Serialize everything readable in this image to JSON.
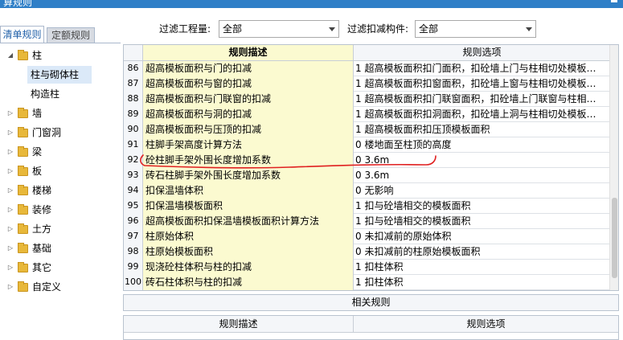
{
  "window": {
    "title": "算规则"
  },
  "tabs": [
    {
      "label": "清单规则",
      "active": true
    },
    {
      "label": "定额规则",
      "active": false
    }
  ],
  "tree": [
    {
      "label": "柱",
      "expanded": true
    },
    {
      "label": "柱与砌体柱",
      "selected": true
    },
    {
      "label": "构造柱"
    },
    {
      "label": "墙"
    },
    {
      "label": "门窗洞"
    },
    {
      "label": "梁"
    },
    {
      "label": "板"
    },
    {
      "label": "楼梯"
    },
    {
      "label": "装修"
    },
    {
      "label": "土方"
    },
    {
      "label": "基础"
    },
    {
      "label": "其它"
    },
    {
      "label": "自定义"
    }
  ],
  "filters": {
    "quantity_label": "过滤工程量:",
    "quantity_value": "全部",
    "component_label": "过滤扣减构件:",
    "component_value": "全部"
  },
  "grid": {
    "headers": {
      "desc": "规则描述",
      "option": "规则选项"
    },
    "rows": [
      {
        "num": "86",
        "desc": "超高模板面积与门的扣减",
        "val": "1 超高模板面积扣门面积，扣砼墙上门与柱相切处模板…"
      },
      {
        "num": "87",
        "desc": "超高模板面积与窗的扣减",
        "val": "1 超高模板面积扣窗面积，扣砼墙上窗与柱相切处模板…"
      },
      {
        "num": "88",
        "desc": "超高模板面积与门联窗的扣减",
        "val": "1 超高模板面积扣门联窗面积，扣砼墙上门联窗与柱相…"
      },
      {
        "num": "89",
        "desc": "超高模板面积与洞的扣减",
        "val": "1 超高模板面积扣洞面积，扣砼墙上洞与柱相切处模板…"
      },
      {
        "num": "90",
        "desc": "超高模板面积与压顶的扣减",
        "val": "1 超高模板面积扣压顶模板面积"
      },
      {
        "num": "91",
        "desc": "柱脚手架高度计算方法",
        "val": "0 楼地面至柱顶的高度"
      },
      {
        "num": "92",
        "desc": "砼柱脚手架外围长度增加系数",
        "val": "0 3.6m"
      },
      {
        "num": "93",
        "desc": "砖石柱脚手架外围长度增加系数",
        "val": "0 3.6m"
      },
      {
        "num": "94",
        "desc": "扣保温墙体积",
        "val": "0  无影响"
      },
      {
        "num": "95",
        "desc": "扣保温墙模板面积",
        "val": "1 扣与砼墙相交的模板面积"
      },
      {
        "num": "96",
        "desc": "超高模板面积扣保温墙模板面积计算方法",
        "val": "1 扣与砼墙相交的模板面积"
      },
      {
        "num": "97",
        "desc": "柱原始体积",
        "val": "0 未扣减前的原始体积"
      },
      {
        "num": "98",
        "desc": "柱原始模板面积",
        "val": "0 未扣减前的柱原始模板面积"
      },
      {
        "num": "99",
        "desc": "现浇砼柱体积与柱的扣减",
        "val": "1 扣柱体积"
      },
      {
        "num": "100",
        "desc": "砖石柱体积与柱的扣减",
        "val": "1 扣柱体积"
      }
    ]
  },
  "related": {
    "button_label": "相关规则",
    "headers": {
      "desc": "规则描述",
      "option": "规则选项"
    }
  },
  "colors": {
    "annotation": "#e02020",
    "desc_bg": "#fbfad0",
    "selection": "#dbe9f8"
  }
}
